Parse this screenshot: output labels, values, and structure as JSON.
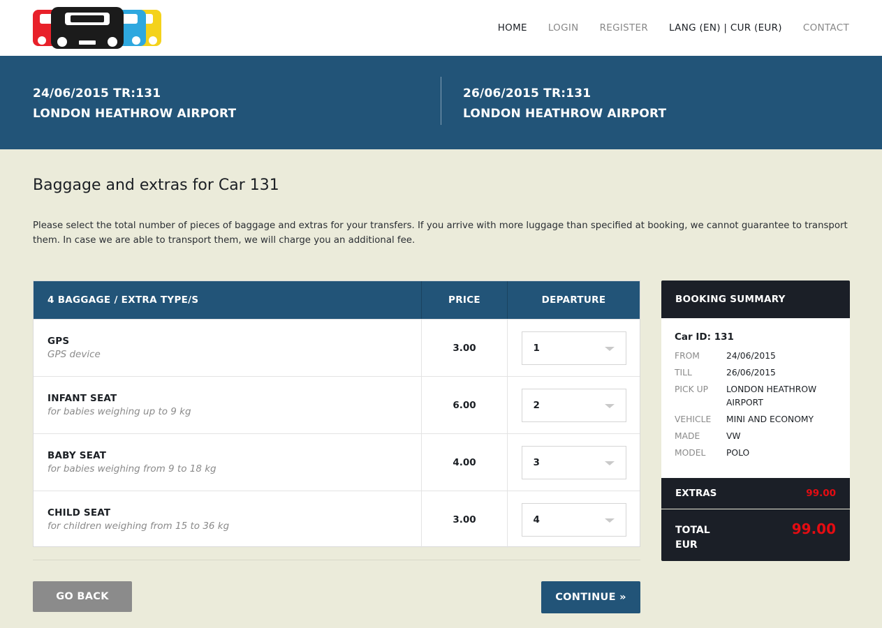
{
  "nav": {
    "home": "HOME",
    "login": "LOGIN",
    "register": "REGISTER",
    "lang_cur": "LANG (EN) | CUR (EUR)",
    "contact": "CONTACT"
  },
  "trip": {
    "outbound": {
      "line1": "24/06/2015 TR:131",
      "line2": "LONDON HEATHROW AIRPORT"
    },
    "return": {
      "line1": "26/06/2015 TR:131",
      "line2": "LONDON HEATHROW AIRPORT"
    }
  },
  "page": {
    "title": "Baggage and extras for Car 131",
    "intro": "Please select the total number of pieces of baggage and extras for your transfers. If you arrive with more luggage than specified at booking, we cannot guarantee to transport them. In case we are able to transport them, we will charge you an additional fee."
  },
  "table": {
    "headers": {
      "type": "4 BAGGAGE / EXTRA TYPE/S",
      "price": "PRICE",
      "departure": "DEPARTURE"
    },
    "rows": [
      {
        "name": "GPS",
        "desc": "GPS device",
        "price": "3.00",
        "qty": "1"
      },
      {
        "name": "INFANT SEAT",
        "desc": "for babies weighing up to 9 kg",
        "price": "6.00",
        "qty": "2"
      },
      {
        "name": "BABY SEAT",
        "desc": "for babies weighing from 9 to 18 kg",
        "price": "4.00",
        "qty": "3"
      },
      {
        "name": "CHILD SEAT",
        "desc": "for children weighing from 15 to 36 kg",
        "price": "3.00",
        "qty": "4"
      }
    ]
  },
  "buttons": {
    "back": "GO BACK",
    "continue": "CONTINUE »"
  },
  "summary": {
    "title": "BOOKING SUMMARY",
    "car_id": "Car ID: 131",
    "from_label": "FROM",
    "from": "24/06/2015",
    "till_label": "TILL",
    "till": "26/06/2015",
    "pickup_label": "PICK UP",
    "pickup": "LONDON HEATHROW AIRPORT",
    "vehicle_label": "VEHICLE",
    "vehicle": "MINI AND ECONOMY",
    "made_label": "MADE",
    "made": "VW",
    "model_label": "MODEL",
    "model": "POLO",
    "extras_label": "EXTRAS",
    "extras_amount": "99.00",
    "total_label_1": "TOTAL",
    "total_label_2": "EUR",
    "total_amount": "99.00"
  },
  "colors": {
    "brand_blue": "#225478",
    "dark": "#1b1f27",
    "accent_red": "#e40c12",
    "background": "#ebebda",
    "logo_colors": [
      "#e8212a",
      "#1b1b1b",
      "#2ea8df",
      "#f4d21b"
    ]
  },
  "icons": {
    "logo": "cars-logo",
    "select_arrow": "chevron-down-icon"
  }
}
